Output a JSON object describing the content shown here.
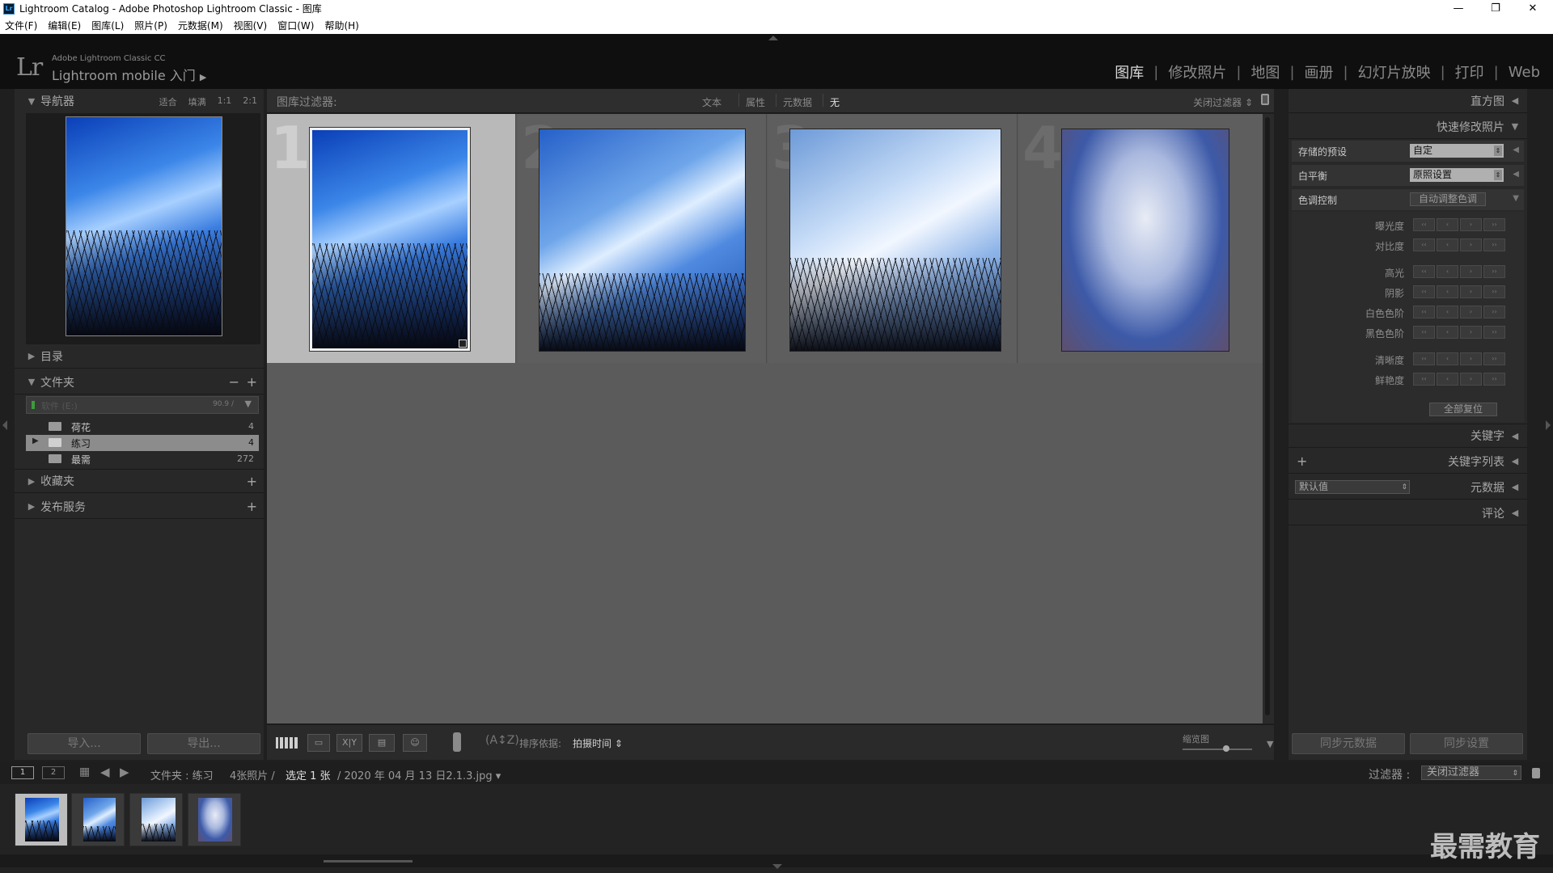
{
  "window": {
    "title": "Lightroom Catalog - Adobe Photoshop Lightroom Classic - 图库",
    "app_icon": "Lr",
    "minimize": "—",
    "maximize": "❐",
    "close": "✕"
  },
  "menu": [
    "文件(F)",
    "编辑(E)",
    "图库(L)",
    "照片(P)",
    "元数据(M)",
    "视图(V)",
    "窗口(W)",
    "帮助(H)"
  ],
  "identity": {
    "logo": "Lr",
    "product": "Adobe Lightroom Classic CC",
    "mobile": "Lightroom mobile 入门",
    "arrow": "▶"
  },
  "modules": {
    "items": [
      "图库",
      "修改照片",
      "地图",
      "画册",
      "幻灯片放映",
      "打印",
      "Web"
    ],
    "sep": "|"
  },
  "left": {
    "navigator": {
      "label": "导航器",
      "zoom": [
        "适合",
        "填满",
        "1:1",
        "2:1"
      ]
    },
    "catalog": {
      "label": "目录"
    },
    "folders": {
      "label": "文件夹",
      "minus": "−",
      "plus": "+",
      "volume": {
        "name": "软件 (E:)",
        "size": "90.9 /"
      },
      "items": [
        {
          "name": "荷花",
          "count": "4"
        },
        {
          "name": "练习",
          "count": "4"
        },
        {
          "name": "最需",
          "count": "272"
        }
      ]
    },
    "collections": {
      "label": "收藏夹",
      "plus": "+"
    },
    "publish": {
      "label": "发布服务",
      "plus": "+"
    },
    "import": "导入...",
    "export": "导出..."
  },
  "filterbar": {
    "label": "图库过滤器:",
    "tabs": [
      "文本",
      "属性",
      "元数据",
      "无"
    ],
    "close": "关闭过滤器",
    "lock_icon": "lock-icon"
  },
  "grid": {
    "cells": [
      {
        "num": "1"
      },
      {
        "num": "2"
      },
      {
        "num": "3"
      },
      {
        "num": "4"
      }
    ]
  },
  "toolbar": {
    "sort_label": "排序依据:",
    "sort_value": "拍摄时间",
    "thumb_label": "缩览图",
    "survey": "X|Y"
  },
  "right": {
    "histogram": "直方图",
    "quick_develop": "快速修改照片",
    "saved_preset": {
      "label": "存储的预设",
      "value": "自定"
    },
    "white_balance": {
      "label": "白平衡",
      "value": "原照设置"
    },
    "tone_control": {
      "label": "色调控制",
      "auto": "自动调整色调"
    },
    "sliders": [
      "曝光度",
      "对比度",
      "高光",
      "阴影",
      "白色色阶",
      "黑色色阶",
      "清晰度",
      "鲜艳度"
    ],
    "stepper": [
      "‹‹",
      "‹",
      "›",
      "››"
    ],
    "reset": "全部复位",
    "keywording": "关键字",
    "keyword_list": "关键字列表",
    "metadata": {
      "label": "元数据",
      "preset": "默认值"
    },
    "comments": "评论",
    "sync_metadata": "同步元数据",
    "sync_settings": "同步设置"
  },
  "filmstrip": {
    "screens": [
      "1",
      "2"
    ],
    "path": "文件夹 : 练习",
    "count": "4张照片 /",
    "selected": "选定 1 张",
    "file": "/ 2020 年 04 月 13 日2.1.3.jpg",
    "filter_label": "过滤器 :",
    "filter_value": "关闭过滤器"
  },
  "watermark": "最需教育"
}
